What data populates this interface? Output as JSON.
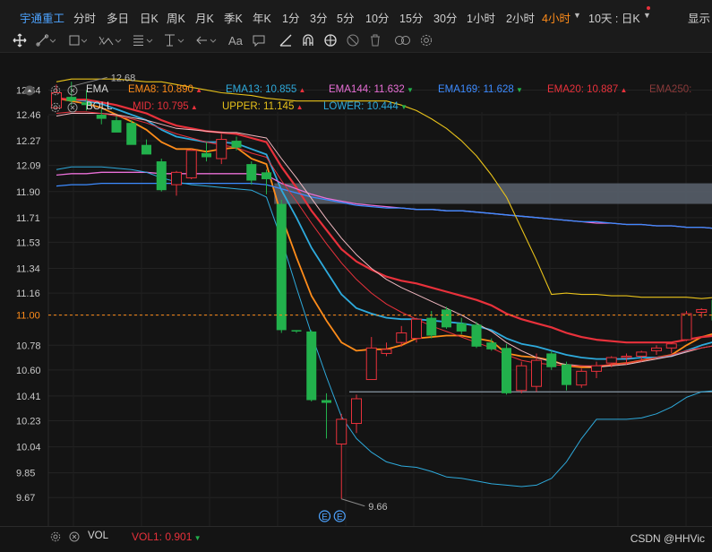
{
  "topbar": {
    "stock_name": "宇通重工",
    "timeframes": [
      "分时",
      "多日",
      "日K",
      "周K",
      "月K",
      "季K",
      "年K",
      "1分",
      "3分",
      "5分",
      "10分",
      "15分",
      "30分",
      "1小时",
      "2小时",
      "4小时"
    ],
    "active_timeframe": "4小时",
    "extra_dropdown": "10天 : 日K",
    "display_label": "显示"
  },
  "indicators": {
    "ema": {
      "name": "EMA",
      "items": [
        {
          "label": "EMA8:",
          "value": "10.890",
          "color": "#ff8c1a",
          "dir": "up"
        },
        {
          "label": "EMA13:",
          "value": "10.855",
          "color": "#2eaadc",
          "dir": "up"
        },
        {
          "label": "EMA144:",
          "value": "11.632",
          "color": "#e86fd6",
          "dir": "down"
        },
        {
          "label": "EMA169:",
          "value": "11.628",
          "color": "#3d8bff",
          "dir": "down"
        },
        {
          "label": "EMA20:",
          "value": "10.887",
          "color": "#e8313b",
          "dir": "up"
        },
        {
          "label": "EMA250:",
          "value": "",
          "color": "#8a3a3a",
          "dir": ""
        }
      ]
    },
    "boll": {
      "name": "BOLL",
      "items": [
        {
          "label": "MID:",
          "value": "10.795",
          "color": "#e8313b",
          "dir": "up"
        },
        {
          "label": "UPPER:",
          "value": "11.145",
          "color": "#e8c21a",
          "dir": "up"
        },
        {
          "label": "LOWER:",
          "value": "10.444",
          "color": "#2eaadc",
          "dir": "down"
        }
      ]
    },
    "vol": {
      "name": "VOL",
      "items": [
        {
          "label": "VOL1:",
          "value": "0.901",
          "color": "#e8313b",
          "dir": "down"
        }
      ]
    }
  },
  "watermark": "CSDN @HHVic",
  "chart_data": {
    "type": "candlestick",
    "yticks": [
      "12.64",
      "12.46",
      "12.27",
      "12.09",
      "11.90",
      "11.71",
      "11.53",
      "11.34",
      "11.16",
      "11.00",
      "10.78",
      "10.60",
      "10.41",
      "10.23",
      "10.04",
      "9.85",
      "9.67"
    ],
    "ylim": [
      9.58,
      12.78
    ],
    "current_price": 11.0,
    "current_price_label": "11.00",
    "high_marker": {
      "value": 12.68,
      "label": "12.68",
      "index": 1
    },
    "low_marker": {
      "value": 9.66,
      "label": "9.66",
      "index": 19
    },
    "event_markers": [
      {
        "label": "E",
        "index": 18
      },
      {
        "label": "E",
        "index": 19
      }
    ],
    "candles": [
      {
        "o": 12.51,
        "h": 12.68,
        "l": 12.5,
        "c": 12.62
      },
      {
        "o": 12.59,
        "h": 12.7,
        "l": 12.53,
        "c": 12.56
      },
      {
        "o": 12.55,
        "h": 12.64,
        "l": 12.49,
        "c": 12.53
      },
      {
        "o": 12.46,
        "h": 12.5,
        "l": 12.39,
        "c": 12.43
      },
      {
        "o": 12.42,
        "h": 12.45,
        "l": 12.34,
        "c": 12.33
      },
      {
        "o": 12.4,
        "h": 12.42,
        "l": 12.26,
        "c": 12.24
      },
      {
        "o": 12.24,
        "h": 12.28,
        "l": 12.18,
        "c": 12.17
      },
      {
        "o": 12.12,
        "h": 12.14,
        "l": 11.9,
        "c": 11.91
      },
      {
        "o": 11.95,
        "h": 12.05,
        "l": 11.87,
        "c": 12.04
      },
      {
        "o": 12.0,
        "h": 12.21,
        "l": 11.99,
        "c": 12.2
      },
      {
        "o": 12.18,
        "h": 12.26,
        "l": 12.12,
        "c": 12.15
      },
      {
        "o": 12.14,
        "h": 12.32,
        "l": 12.1,
        "c": 12.28
      },
      {
        "o": 12.27,
        "h": 12.3,
        "l": 12.2,
        "c": 12.22
      },
      {
        "o": 12.1,
        "h": 12.12,
        "l": 11.95,
        "c": 11.98
      },
      {
        "o": 12.04,
        "h": 12.06,
        "l": 11.88,
        "c": 11.99
      },
      {
        "o": 11.81,
        "h": 11.84,
        "l": 10.87,
        "c": 10.89
      },
      {
        "o": 10.89,
        "h": 10.89,
        "l": 10.87,
        "c": 10.88
      },
      {
        "o": 10.88,
        "h": 10.89,
        "l": 10.37,
        "c": 10.38
      },
      {
        "o": 10.38,
        "h": 10.43,
        "l": 10.1,
        "c": 10.36
      },
      {
        "o": 10.06,
        "h": 10.28,
        "l": 9.66,
        "c": 10.24
      },
      {
        "o": 10.21,
        "h": 10.42,
        "l": 10.14,
        "c": 10.39
      },
      {
        "o": 10.53,
        "h": 10.84,
        "l": 10.53,
        "c": 10.76
      },
      {
        "o": 10.72,
        "h": 10.8,
        "l": 10.7,
        "c": 10.75
      },
      {
        "o": 10.8,
        "h": 10.92,
        "l": 10.77,
        "c": 10.87
      },
      {
        "o": 10.83,
        "h": 10.98,
        "l": 10.8,
        "c": 10.97
      },
      {
        "o": 10.98,
        "h": 11.03,
        "l": 10.83,
        "c": 10.85
      },
      {
        "o": 11.04,
        "h": 11.06,
        "l": 10.9,
        "c": 10.91
      },
      {
        "o": 10.94,
        "h": 10.98,
        "l": 10.86,
        "c": 10.88
      },
      {
        "o": 10.93,
        "h": 10.95,
        "l": 10.76,
        "c": 10.77
      },
      {
        "o": 10.8,
        "h": 10.83,
        "l": 10.74,
        "c": 10.75
      },
      {
        "o": 10.76,
        "h": 10.79,
        "l": 10.42,
        "c": 10.43
      },
      {
        "o": 10.45,
        "h": 10.66,
        "l": 10.43,
        "c": 10.63
      },
      {
        "o": 10.48,
        "h": 10.72,
        "l": 10.44,
        "c": 10.67
      },
      {
        "o": 10.72,
        "h": 10.74,
        "l": 10.6,
        "c": 10.62
      },
      {
        "o": 10.64,
        "h": 10.66,
        "l": 10.45,
        "c": 10.49
      },
      {
        "o": 10.49,
        "h": 10.61,
        "l": 10.47,
        "c": 10.59
      },
      {
        "o": 10.59,
        "h": 10.66,
        "l": 10.54,
        "c": 10.63
      },
      {
        "o": 10.65,
        "h": 10.7,
        "l": 10.62,
        "c": 10.69
      },
      {
        "o": 10.69,
        "h": 10.72,
        "l": 10.64,
        "c": 10.7
      },
      {
        "o": 10.7,
        "h": 10.74,
        "l": 10.66,
        "c": 10.73
      },
      {
        "o": 10.74,
        "h": 10.78,
        "l": 10.71,
        "c": 10.76
      },
      {
        "o": 10.76,
        "h": 10.8,
        "l": 10.72,
        "c": 10.79
      },
      {
        "o": 10.82,
        "h": 11.03,
        "l": 10.81,
        "c": 11.01
      },
      {
        "o": 11.02,
        "h": 11.05,
        "l": 10.98,
        "c": 11.04
      },
      {
        "o": 11.11,
        "h": 11.14,
        "l": 10.95,
        "c": 10.96
      },
      {
        "o": 10.96,
        "h": 11.04,
        "l": 10.95,
        "c": 11.02
      }
    ],
    "lines": [
      {
        "name": "EMA8",
        "color": "#ff8c1a",
        "width": 1.8,
        "values": [
          12.58,
          12.56,
          12.54,
          12.51,
          12.46,
          12.41,
          12.35,
          12.26,
          12.21,
          12.21,
          12.19,
          12.21,
          12.22,
          12.14,
          12.1,
          11.72,
          11.42,
          11.14,
          10.96,
          10.8,
          10.74,
          10.75,
          10.75,
          10.78,
          10.83,
          10.84,
          10.85,
          10.85,
          10.83,
          10.81,
          10.72,
          10.7,
          10.69,
          10.67,
          10.63,
          10.62,
          10.62,
          10.64,
          10.65,
          10.67,
          10.69,
          10.71,
          10.78,
          10.84,
          10.87,
          10.89
        ]
      },
      {
        "name": "EMA13",
        "color": "#2eaadc",
        "width": 1.8,
        "values": [
          12.58,
          12.57,
          12.56,
          12.54,
          12.5,
          12.46,
          12.42,
          12.35,
          12.3,
          12.28,
          12.26,
          12.26,
          12.25,
          12.21,
          12.17,
          11.91,
          11.71,
          11.49,
          11.32,
          11.15,
          11.05,
          11.01,
          10.98,
          10.97,
          10.97,
          10.96,
          10.95,
          10.94,
          10.92,
          10.89,
          10.83,
          10.79,
          10.77,
          10.74,
          10.71,
          10.69,
          10.68,
          10.68,
          10.68,
          10.69,
          10.69,
          10.7,
          10.74,
          10.78,
          10.81,
          10.83
        ]
      },
      {
        "name": "EMA20",
        "color": "#e8313b",
        "width": 2.2,
        "values": [
          12.58,
          12.57,
          12.57,
          12.55,
          12.53,
          12.5,
          12.47,
          12.42,
          12.38,
          12.36,
          12.34,
          12.33,
          12.32,
          12.29,
          12.26,
          12.08,
          11.93,
          11.76,
          11.62,
          11.48,
          11.39,
          11.33,
          11.28,
          11.25,
          11.23,
          11.2,
          11.17,
          11.14,
          11.11,
          11.07,
          11.01,
          10.97,
          10.94,
          10.91,
          10.87,
          10.84,
          10.82,
          10.81,
          10.8,
          10.8,
          10.8,
          10.8,
          10.82,
          10.84,
          10.85,
          10.87
        ]
      },
      {
        "name": "EMA144",
        "color": "#e86fd6",
        "width": 1.3,
        "values": [
          12.02,
          12.03,
          12.03,
          12.04,
          12.04,
          12.04,
          12.04,
          12.03,
          12.03,
          12.03,
          12.03,
          12.03,
          12.03,
          12.03,
          12.02,
          11.96,
          11.92,
          11.88,
          11.85,
          11.83,
          11.81,
          11.8,
          11.79,
          11.78,
          11.77,
          11.77,
          11.76,
          11.76,
          11.75,
          11.74,
          11.73,
          11.72,
          11.71,
          11.7,
          11.69,
          11.68,
          11.67,
          11.67,
          11.66,
          11.66,
          11.65,
          11.65,
          11.64,
          11.64,
          11.63,
          11.63
        ]
      },
      {
        "name": "EMA169",
        "color": "#3d8bff",
        "width": 1.3,
        "values": [
          11.94,
          11.95,
          11.95,
          11.96,
          11.96,
          11.96,
          11.96,
          11.96,
          11.96,
          11.96,
          11.96,
          11.96,
          11.96,
          11.96,
          11.95,
          11.92,
          11.89,
          11.86,
          11.84,
          11.82,
          11.8,
          11.79,
          11.78,
          11.78,
          11.77,
          11.77,
          11.76,
          11.76,
          11.75,
          11.74,
          11.73,
          11.72,
          11.71,
          11.7,
          11.69,
          11.68,
          11.68,
          11.67,
          11.66,
          11.66,
          11.65,
          11.65,
          11.64,
          11.64,
          11.63,
          11.63
        ]
      },
      {
        "name": "EMA250",
        "color": "#f0b8c0",
        "width": 1.0,
        "values": [
          12.45,
          12.47,
          12.47,
          12.47,
          12.46,
          12.44,
          12.42,
          12.39,
          12.36,
          12.35,
          12.34,
          12.33,
          12.33,
          12.31,
          12.29,
          12.14,
          12.0,
          11.85,
          11.7,
          11.56,
          11.44,
          11.34,
          11.26,
          11.2,
          11.15,
          11.1,
          11.05,
          11.0,
          10.94,
          10.88,
          10.8,
          10.74,
          10.69,
          10.66,
          10.64,
          10.63,
          10.62,
          10.63,
          10.64,
          10.66,
          10.68,
          10.7,
          10.73,
          10.76,
          10.78,
          10.8
        ]
      },
      {
        "name": "UPPER",
        "color": "#e8c21a",
        "width": 1.1,
        "values": [
          12.7,
          12.72,
          12.72,
          12.72,
          12.72,
          12.71,
          12.7,
          12.7,
          12.68,
          12.66,
          12.64,
          12.62,
          12.61,
          12.6,
          12.58,
          12.57,
          12.56,
          12.56,
          12.56,
          12.56,
          12.56,
          12.56,
          12.56,
          12.53,
          12.49,
          12.43,
          12.36,
          12.27,
          12.16,
          12.02,
          11.86,
          11.63,
          11.4,
          11.15,
          11.16,
          11.15,
          11.15,
          11.14,
          11.14,
          11.13,
          11.13,
          11.13,
          11.13,
          11.12,
          11.13,
          11.15
        ]
      },
      {
        "name": "MID",
        "color": "#e8313b",
        "width": 1.0,
        "values": [
          12.47,
          12.48,
          12.48,
          12.47,
          12.45,
          12.43,
          12.4,
          12.36,
          12.32,
          12.29,
          12.26,
          12.24,
          12.22,
          12.18,
          12.15,
          11.98,
          11.83,
          11.67,
          11.52,
          11.38,
          11.26,
          11.16,
          11.08,
          11.02,
          10.97,
          10.92,
          10.88,
          10.84,
          10.8,
          10.76,
          10.71,
          10.67,
          10.65,
          10.64,
          10.63,
          10.63,
          10.63,
          10.64,
          10.65,
          10.67,
          10.69,
          10.71,
          10.74,
          10.76,
          10.78,
          10.8
        ]
      },
      {
        "name": "LOWER",
        "color": "#2eaadc",
        "width": 1.0,
        "values": [
          12.06,
          12.08,
          12.08,
          12.08,
          12.07,
          12.06,
          12.04,
          12.0,
          11.97,
          11.95,
          11.94,
          11.93,
          11.92,
          11.91,
          11.86,
          11.55,
          11.2,
          10.86,
          10.55,
          10.26,
          10.1,
          10.0,
          9.93,
          9.9,
          9.89,
          9.86,
          9.82,
          9.81,
          9.79,
          9.77,
          9.76,
          9.75,
          9.76,
          9.81,
          9.93,
          10.1,
          10.24,
          10.24,
          10.24,
          10.25,
          10.28,
          10.33,
          10.4,
          10.44,
          10.45,
          10.44
        ]
      }
    ],
    "zones": [
      {
        "from_index": 15,
        "to_index": 45,
        "top": 11.96,
        "bottom": 11.81,
        "color": "#5a636e"
      },
      {
        "from_index": 20,
        "to_index": 45,
        "top": 10.44,
        "bottom": 10.44,
        "color": "#7d8a96"
      }
    ]
  }
}
